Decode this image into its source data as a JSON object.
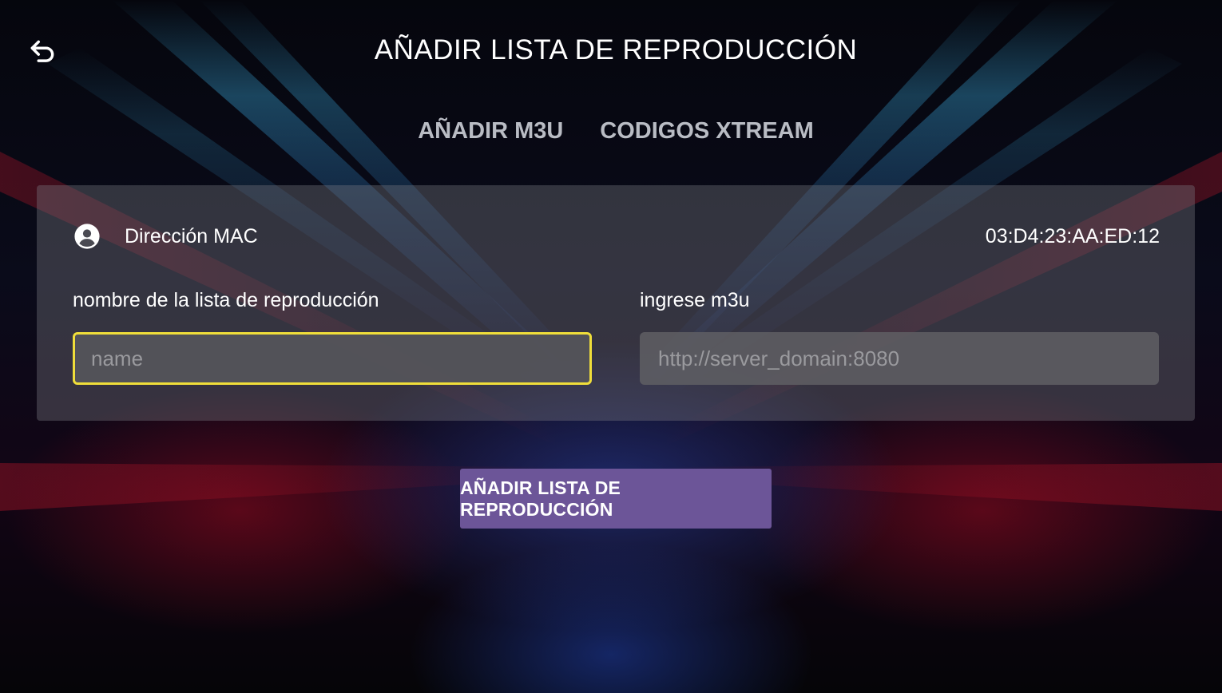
{
  "header": {
    "back_icon": "back-arrow-icon",
    "title": "AÑADIR LISTA DE REPRODUCCIÓN"
  },
  "tabs": [
    {
      "label": "AÑADIR M3U"
    },
    {
      "label": "CODIGOS XTREAM"
    }
  ],
  "panel": {
    "mac": {
      "icon": "user-circle-icon",
      "label": "Dirección MAC",
      "value": "03:D4:23:AA:ED:12"
    },
    "playlist_name": {
      "label": "nombre de la lista de reproducción",
      "placeholder": "name",
      "value": ""
    },
    "m3u_url": {
      "label": "ingrese m3u",
      "placeholder": "http://server_domain:8080",
      "value": ""
    }
  },
  "submit": {
    "label": "AÑADIR LISTA DE REPRODUCCIÓN"
  },
  "colors": {
    "focus_border": "#f0de3a",
    "button_bg": "#6c5598",
    "panel_bg": "rgba(120,120,130,0.38)"
  }
}
